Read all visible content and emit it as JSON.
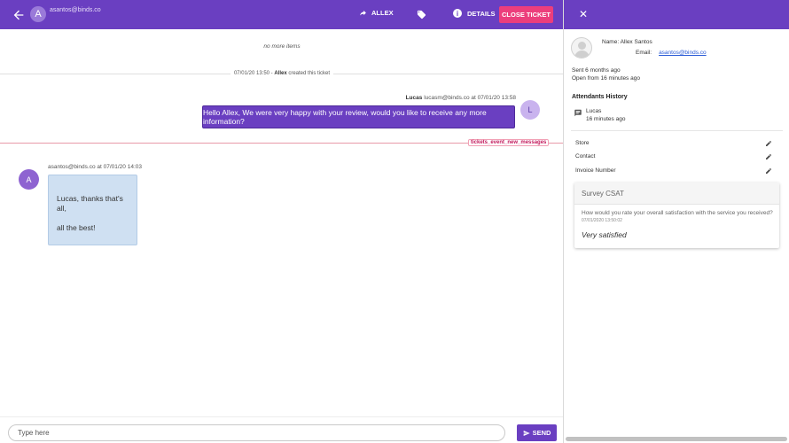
{
  "header": {
    "avatar_letter": "A",
    "email": "asantos@binds.co",
    "transfer_label": "ALLEX",
    "details_label": "DETAILS",
    "close_ticket_label": "CLOSE TICKET"
  },
  "chat": {
    "no_more_items": "no more items",
    "created": {
      "time": "07/01/20 13:50 -",
      "agent": "Allex",
      "text": "created this ticket"
    },
    "outgoing": {
      "sender": "Lucas",
      "meta": "lucasm@binds.co at 07/01/20 13:58",
      "avatar_letter": "L",
      "text": "Hello Allex, We were very happy with your review, would you like to receive any more information?"
    },
    "new_messages_tag": "tickets_event_new_messages",
    "incoming": {
      "meta": "asantos@binds.co at 07/01/20 14:03",
      "avatar_letter": "A",
      "line1": "Lucas, thanks that's all,",
      "line2": "all the best!"
    }
  },
  "composer": {
    "placeholder": "Type here",
    "send_label": "SEND"
  },
  "details": {
    "name": "Name: Allex Santos",
    "email_label": "Email:",
    "email_value": "asantos@binds.co",
    "sent": "Sent 6 months ago",
    "open_from": "Open from 16 minutes ago",
    "attendants_title": "Attendants History",
    "attendant_name": "Lucas",
    "attendant_time": "16 minutes ago",
    "fields": [
      "Store",
      "Contact",
      "Invoice Number"
    ],
    "survey": {
      "title": "Survey CSAT",
      "question": "How would you rate your overall satisfaction with the service you received?",
      "date": "07/01/2020 13:50:02",
      "answer": "Very satisfied"
    }
  }
}
